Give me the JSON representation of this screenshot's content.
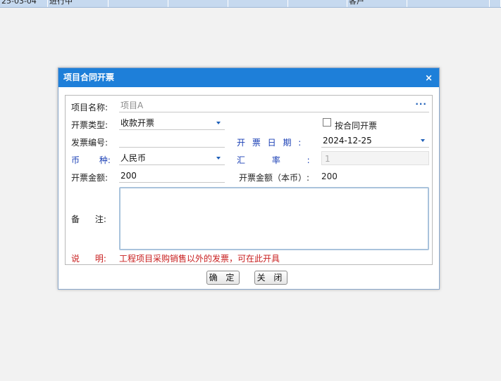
{
  "background_row": {
    "cells": [
      "25-03-04",
      "进行中",
      "",
      "",
      "",
      "",
      "客户",
      "",
      ""
    ]
  },
  "dialog": {
    "title": "项目合同开票",
    "close_glyph": "×",
    "form": {
      "project_name": {
        "label": "项目名称:",
        "value": "项目A",
        "browse_glyph": "···"
      },
      "invoice_type": {
        "label": "开票类型:",
        "value": "收款开票"
      },
      "by_contract": {
        "label": "按合同开票",
        "checked": false
      },
      "invoice_no": {
        "label": "发票编号:",
        "value": ""
      },
      "invoice_date": {
        "label": "开 票 日 期 :",
        "value": "2024-12-25"
      },
      "currency": {
        "label": "币 种:",
        "value": "人民币"
      },
      "exchange_rate": {
        "label": "汇 率 :",
        "value": "1"
      },
      "amount": {
        "label": "开票金额:",
        "value": "200"
      },
      "amount_local": {
        "label": "开票金额（本币）:",
        "value": "200"
      },
      "remark": {
        "label": "备 注:",
        "value": ""
      },
      "note": {
        "label": "说 明:",
        "text": "工程项目采购销售以外的发票，可在此开具"
      }
    },
    "buttons": {
      "confirm": "确 定",
      "close": "关 闭"
    }
  },
  "colors": {
    "header": "#1e7fd9",
    "label_blue": "#1a3fb5",
    "note_red": "#c81e1e",
    "grid_bg": "#c6d9ef"
  }
}
